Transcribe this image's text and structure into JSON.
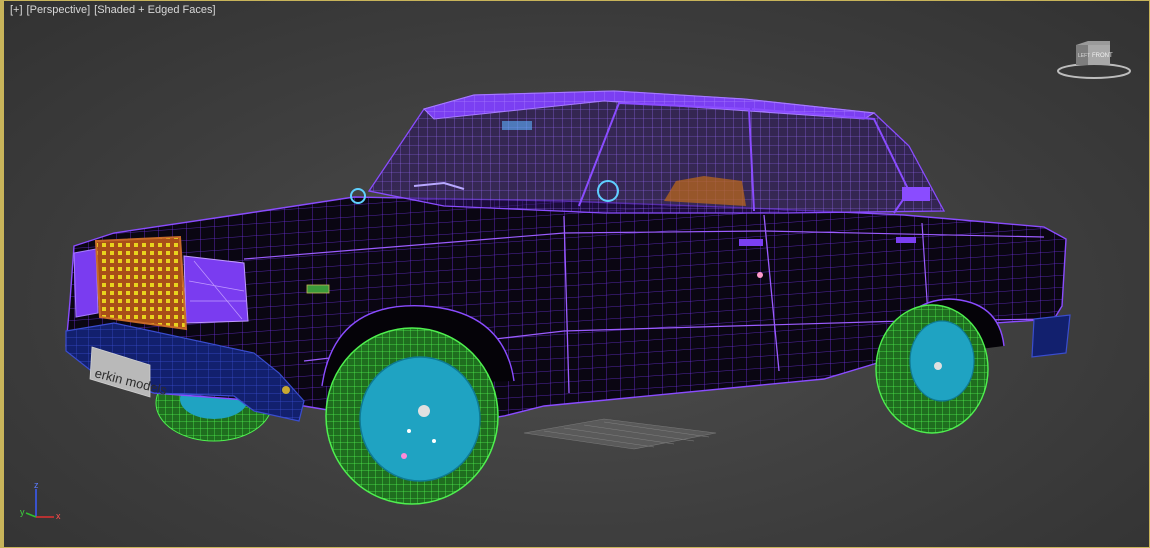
{
  "viewport": {
    "menu_label": "[+]",
    "view_label": "[Perspective]",
    "shading_label": "[Shaded + Edged Faces]"
  },
  "viewcube": {
    "left_face": "LEFT",
    "front_face": "FRONT"
  },
  "model": {
    "plate_text": "erkin models"
  },
  "axis_gizmo": {
    "x": "x",
    "y": "y",
    "z": "z"
  },
  "colors": {
    "viewport_border": "#c8b45a",
    "body_wire": "#7a3cf0",
    "body_fill": "#0a0612",
    "tire_wire": "#3fd23f",
    "rim_fill": "#1fa3c2",
    "grille": "#b8561c",
    "bumper": "#12206e"
  }
}
